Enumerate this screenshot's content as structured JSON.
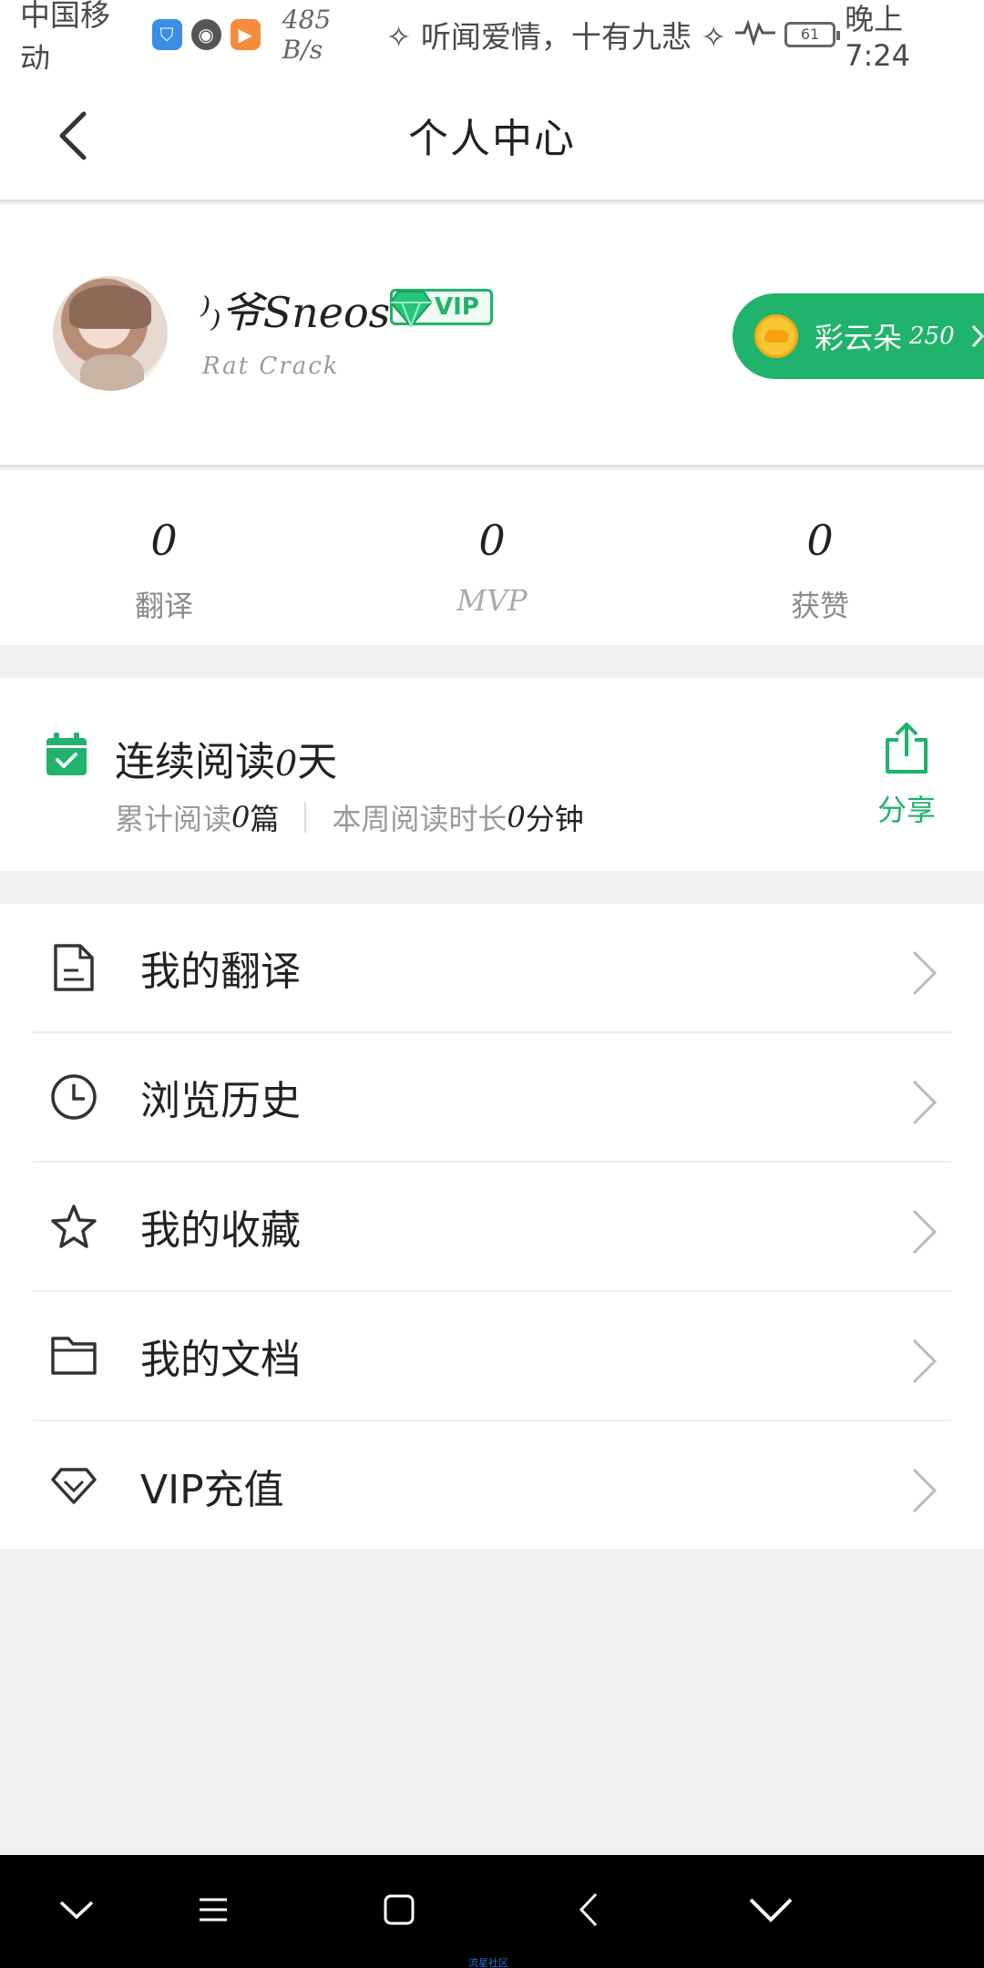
{
  "status_bar": {
    "carrier": "中国移动",
    "speed": "485 B/s",
    "song": "✧ 听闻爱情，十有九悲 ✧",
    "battery": "61",
    "time": "晚上7:24"
  },
  "header": {
    "title": "个人中心"
  },
  "profile": {
    "username": "⁾₎爷Sneos",
    "vip_label": "VIP",
    "subname": "Rat Crack",
    "cloud_label": "彩云朵",
    "cloud_count": "250"
  },
  "stats": [
    {
      "value": "0",
      "label": "翻译"
    },
    {
      "value": "0",
      "label": "MVP"
    },
    {
      "value": "0",
      "label": "获赞"
    }
  ],
  "reading": {
    "title_prefix": "连续阅读",
    "days": "0",
    "title_suffix": "天",
    "total_prefix": "累计阅读 ",
    "total_count": "0",
    "total_suffix": "篇",
    "week_prefix": "本周阅读时长 ",
    "week_minutes": "0",
    "week_suffix": "分钟",
    "share_label": "分享"
  },
  "menu": [
    {
      "label": "我的翻译",
      "icon": "document-icon"
    },
    {
      "label": "浏览历史",
      "icon": "clock-icon"
    },
    {
      "label": "我的收藏",
      "icon": "star-icon"
    },
    {
      "label": "我的文档",
      "icon": "folder-icon"
    },
    {
      "label": "VIP充值",
      "icon": "diamond-icon"
    }
  ],
  "watermark": "流星社区",
  "colors": {
    "accent": "#1fb36b",
    "background": "#f1f1f1",
    "text": "#222222",
    "muted": "#9a9a9a"
  }
}
